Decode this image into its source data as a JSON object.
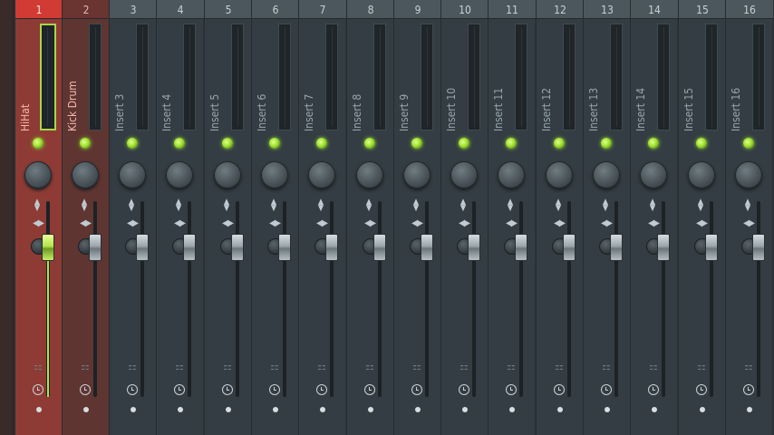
{
  "mixer": {
    "tracks": [
      {
        "number": "1",
        "name": "HiHat"
      },
      {
        "number": "2",
        "name": "Kick Drum"
      },
      {
        "number": "3",
        "name": "Insert 3"
      },
      {
        "number": "4",
        "name": "Insert 4"
      },
      {
        "number": "5",
        "name": "Insert 5"
      },
      {
        "number": "6",
        "name": "Insert 6"
      },
      {
        "number": "7",
        "name": "Insert 7"
      },
      {
        "number": "8",
        "name": "Insert 8"
      },
      {
        "number": "9",
        "name": "Insert 9"
      },
      {
        "number": "10",
        "name": "Insert 10"
      },
      {
        "number": "11",
        "name": "Insert 11"
      },
      {
        "number": "12",
        "name": "Insert 12"
      },
      {
        "number": "13",
        "name": "Insert 13"
      },
      {
        "number": "14",
        "name": "Insert 14"
      },
      {
        "number": "15",
        "name": "Insert 15"
      },
      {
        "number": "16",
        "name": "Insert 16"
      }
    ],
    "selected_track": "1",
    "icons": {
      "route_arrows": "up-down-arrow-icon",
      "pan_arrows": "left-right-arrow-icon",
      "fx": "fx-slot-icon",
      "clock": "clock-icon"
    },
    "colors": {
      "selected": "#d13b34",
      "led_on": "#9ee02f",
      "fader_active": "#b4e34b"
    }
  }
}
